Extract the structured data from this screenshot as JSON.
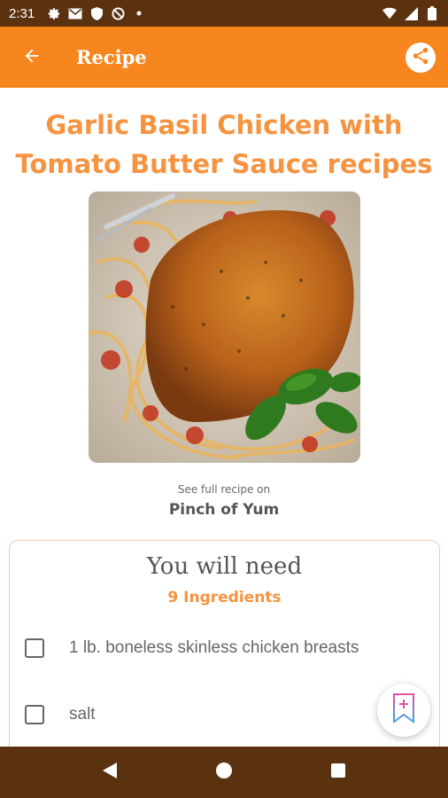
{
  "status_bar": {
    "time": "2:31",
    "icons_left": [
      "gear-icon",
      "gmail-icon",
      "shield-icon",
      "blocked-icon",
      "dot-icon"
    ],
    "icons_right": [
      "wifi-icon",
      "signal-icon",
      "battery-icon"
    ]
  },
  "app_bar": {
    "title": "Recipe",
    "back_icon": "arrow-left-icon",
    "share_icon": "share-icon",
    "background": "#f7861f"
  },
  "recipe": {
    "title": "Garlic Basil Chicken with Tomato Butter Sauce recipes",
    "image": "garlic-basil-chicken-photo",
    "source_caption": "See full recipe on",
    "source_name": "Pinch of Yum"
  },
  "ingredients_card": {
    "heading": "You will need",
    "count_label": "9 Ingredients",
    "items": [
      {
        "text": "1 lb. boneless skinless chicken breasts",
        "checked": false
      },
      {
        "text": "salt",
        "checked": false
      }
    ]
  },
  "fab": {
    "icon": "bookmark-plus-icon"
  },
  "nav_bar": {
    "buttons": [
      "back-triangle-icon",
      "home-circle-icon",
      "recents-square-icon"
    ]
  },
  "colors": {
    "accent": "#f7861f",
    "title_orange": "#f59340",
    "system_bar": "#5b3210"
  }
}
